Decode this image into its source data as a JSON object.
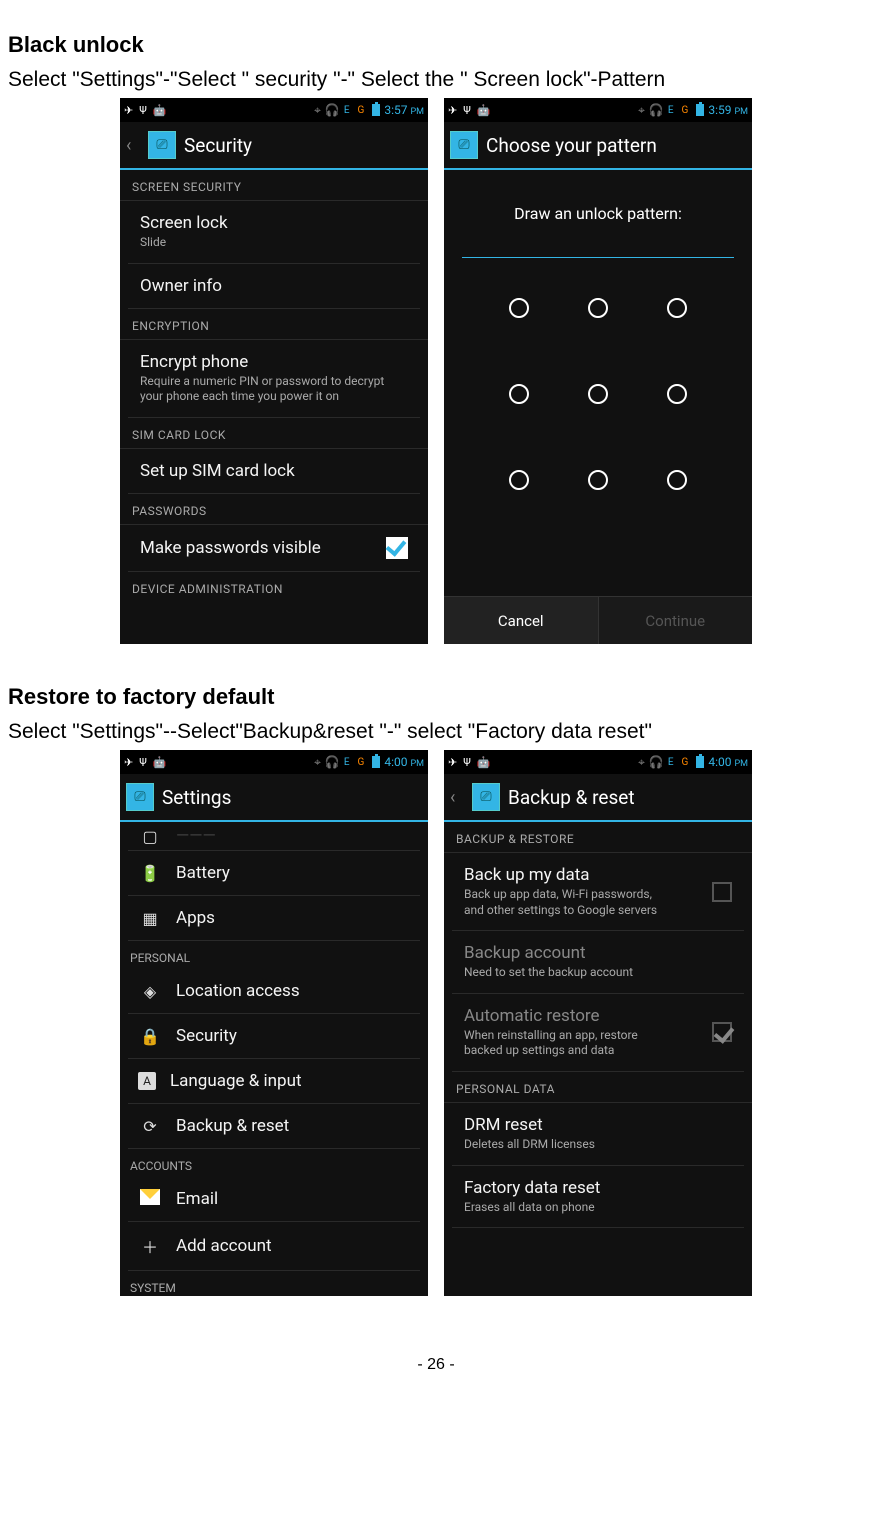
{
  "headings": {
    "black_unlock": "Black unlock",
    "black_unlock_body": "Select \"Settings\"-\"Select \" security \"-\" Select the \" Screen lock\"-Pattern",
    "restore": "Restore to factory default",
    "restore_body": "Select \"Settings\"--Select\"Backup&reset \"-\" select \"Factory data reset\""
  },
  "footer": "- 26 -",
  "times": {
    "t357": "3:57",
    "t359": "3:59",
    "t400": "4:00",
    "pm": "PM"
  },
  "security": {
    "title": "Security",
    "sections": {
      "screen_security": "SCREEN SECURITY",
      "encryption": "ENCRYPTION",
      "sim": "SIM CARD LOCK",
      "passwords": "PASSWORDS",
      "device_admin": "DEVICE ADMINISTRATION"
    },
    "screen_lock": {
      "title": "Screen lock",
      "sub": "Slide"
    },
    "owner_info": "Owner info",
    "encrypt": {
      "title": "Encrypt phone",
      "sub": "Require a numeric PIN or password to decrypt your phone each time you power it on"
    },
    "sim_lock": "Set up SIM card lock",
    "pwd_visible": "Make passwords visible"
  },
  "pattern": {
    "title": "Choose your pattern",
    "instruction": "Draw an unlock pattern:",
    "cancel": "Cancel",
    "cont": "Continue"
  },
  "settings": {
    "title": "Settings",
    "battery": "Battery",
    "apps": "Apps",
    "personal": "PERSONAL",
    "location": "Location access",
    "security": "Security",
    "lang": "Language & input",
    "backup": "Backup & reset",
    "accounts": "ACCOUNTS",
    "email": "Email",
    "add_account": "Add account",
    "system": "SYSTEM"
  },
  "backup": {
    "title": "Backup & reset",
    "section_br": "BACKUP & RESTORE",
    "back_up": {
      "title": "Back up my data",
      "sub": "Back up app data, Wi-Fi passwords, and other settings to Google servers"
    },
    "account": {
      "title": "Backup account",
      "sub": "Need to set the backup account"
    },
    "auto": {
      "title": "Automatic restore",
      "sub": "When reinstalling an app, restore backed up settings and data"
    },
    "section_pd": "PERSONAL DATA",
    "drm": {
      "title": "DRM reset",
      "sub": "Deletes all DRM licenses"
    },
    "factory": {
      "title": "Factory data reset",
      "sub": "Erases all data on phone"
    }
  }
}
